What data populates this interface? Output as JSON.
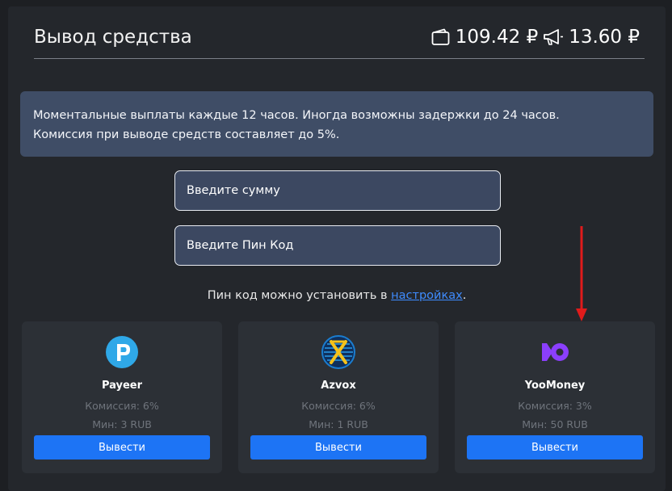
{
  "header": {
    "title": "Вывод средства",
    "balance_amount": "109.42 ₽",
    "bonus_amount": "13.60 ₽"
  },
  "notice": {
    "line1": "Моментальные выплаты каждые 12 часов. Иногда возможны задержки до 24 часов.",
    "line2": "Комиссия при выводе средств составляет до 5%."
  },
  "form": {
    "amount_placeholder": "Введите сумму",
    "pin_placeholder": "Введите Пин Код"
  },
  "pin_hint": {
    "text": "Пин код можно установить в ",
    "link": "настройках",
    "suffix": "."
  },
  "methods": [
    {
      "name": "Payeer",
      "fee": "Комиссия: 6%",
      "min": "Мин: 3 RUB",
      "button": "Вывести",
      "icon": "payeer-logo-icon"
    },
    {
      "name": "Azvox",
      "fee": "Комиссия: 6%",
      "min": "Мин: 1 RUB",
      "button": "Вывести",
      "icon": "azvox-logo-icon"
    },
    {
      "name": "YooMoney",
      "fee": "Комиссия: 3%",
      "min": "Мин: 50 RUB",
      "button": "Вывести",
      "icon": "yoomoney-logo-icon"
    }
  ],
  "colors": {
    "accent": "#1d74f5",
    "notice_bg": "#3f4d66",
    "annotation_arrow": "#e01b1b"
  }
}
